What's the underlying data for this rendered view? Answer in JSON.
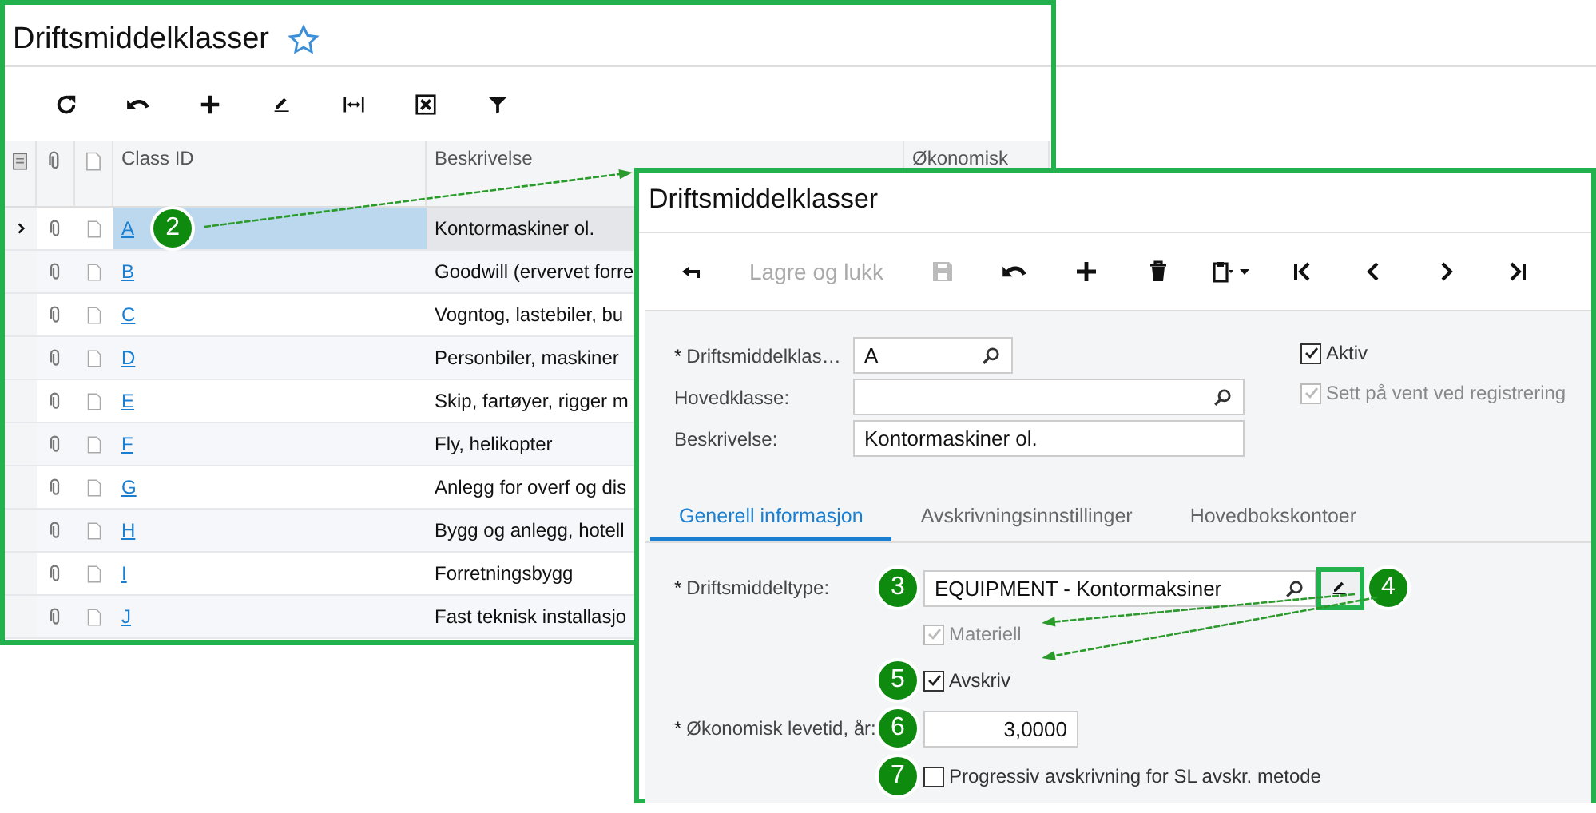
{
  "list_window": {
    "title": "Driftsmiddelklasser",
    "columns": [
      "Class ID",
      "Beskrivelse",
      "Økonomisk"
    ],
    "rows": [
      {
        "class_id": "A",
        "description": "Kontormaskiner ol.",
        "selected": true,
        "badge": "2"
      },
      {
        "class_id": "B",
        "description": "Goodwill (ervervet forre",
        "selected": false
      },
      {
        "class_id": "C",
        "description": "Vogntog, lastebiler, bu",
        "selected": false
      },
      {
        "class_id": "D",
        "description": "Personbiler, maskiner",
        "selected": false
      },
      {
        "class_id": "E",
        "description": "Skip, fartøyer, rigger m",
        "selected": false
      },
      {
        "class_id": "F",
        "description": "Fly, helikopter",
        "selected": false
      },
      {
        "class_id": "G",
        "description": "Anlegg for overf og dis",
        "selected": false
      },
      {
        "class_id": "H",
        "description": "Bygg og anlegg, hotell",
        "selected": false
      },
      {
        "class_id": "I",
        "description": "Forretningsbygg",
        "selected": false
      },
      {
        "class_id": "J",
        "description": "Fast teknisk installasjo",
        "selected": false
      }
    ]
  },
  "form_window": {
    "title": "Driftsmiddelklasser",
    "save_and_close": {
      "label": "Lagre og lukk",
      "disabled": true
    },
    "fields": [
      {
        "kind": "lookup",
        "required": "*",
        "label": "Driftsmiddelklas…",
        "value": "A"
      },
      {
        "kind": "lookup",
        "label": "Hovedklasse:"
      },
      {
        "kind": "text",
        "label": "Beskrivelse:",
        "value": "Kontormaskiner ol."
      }
    ],
    "options": [
      {
        "label": "Aktiv",
        "checked": true,
        "disabled": false
      },
      {
        "label": "Sett på vent ved registrering",
        "checked": true,
        "disabled": true
      }
    ],
    "tabs": [
      {
        "label": "Generell informasjon",
        "selected": true
      },
      {
        "label": "Avskrivningsinnstillinger",
        "selected": false
      },
      {
        "label": "Hovedbokskontoer",
        "selected": false
      }
    ],
    "general": [
      {
        "kind": "lookup",
        "label": "Driftsmiddeltype:",
        "required": "*",
        "value": "EQUIPMENT - Kontormaksiner",
        "badge": "3",
        "edit_badge": "4",
        "edit_highlighted": true
      },
      {
        "kind": "checkbox",
        "label": "Materiell",
        "checked": true,
        "disabled": true
      },
      {
        "kind": "checkbox",
        "label": "Avskriv",
        "checked": true,
        "disabled": false,
        "badge": "5"
      },
      {
        "kind": "number",
        "label": "Økonomisk levetid, år:",
        "required": "*",
        "value": "3,0000",
        "badge": "6"
      },
      {
        "kind": "checkbox",
        "label": "Progressiv avskrivning for SL avskr. metode",
        "checked": false,
        "disabled": false,
        "badge": "7"
      }
    ]
  }
}
